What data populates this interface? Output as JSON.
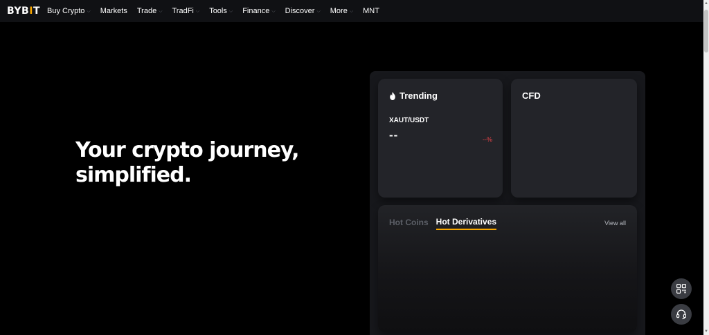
{
  "brand": {
    "logo_prefix": "BYB",
    "logo_accent": "I",
    "logo_suffix": "T",
    "accent_color": "#f7a600"
  },
  "nav": {
    "items": [
      {
        "label": "Buy Crypto",
        "has_dropdown": true
      },
      {
        "label": "Markets",
        "has_dropdown": false
      },
      {
        "label": "Trade",
        "has_dropdown": true
      },
      {
        "label": "TradFi",
        "has_dropdown": true
      },
      {
        "label": "Tools",
        "has_dropdown": true
      },
      {
        "label": "Finance",
        "has_dropdown": true
      },
      {
        "label": "Discover",
        "has_dropdown": true
      },
      {
        "label": "More",
        "has_dropdown": true
      },
      {
        "label": "MNT",
        "has_dropdown": false
      }
    ]
  },
  "hero": {
    "line1": "Your crypto journey,",
    "line2": "simplified."
  },
  "trending": {
    "title": "Trending",
    "icon": "fire-icon",
    "pair": "XAUT/USDT",
    "price": "--",
    "change": "--%",
    "change_color": "#ef454a"
  },
  "cfd": {
    "title": "CFD"
  },
  "hot": {
    "tabs": [
      {
        "label": "Hot Coins",
        "active": false
      },
      {
        "label": "Hot Derivatives",
        "active": true
      }
    ],
    "view_all": "View all"
  },
  "floating": {
    "qr_icon": "qr-code-icon",
    "support_icon": "headset-icon"
  }
}
